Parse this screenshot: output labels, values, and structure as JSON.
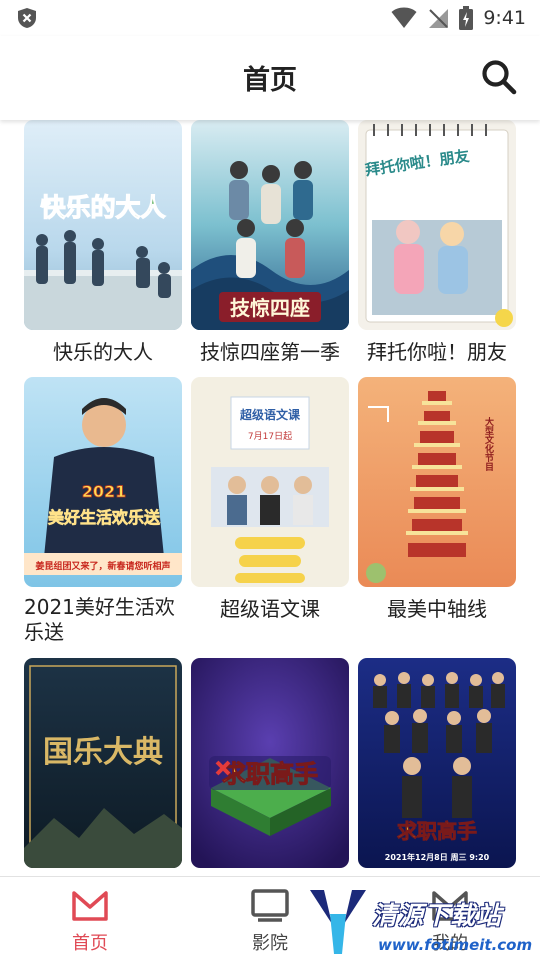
{
  "status_bar": {
    "time": "9:41"
  },
  "header": {
    "title": "首页"
  },
  "shows": [
    {
      "title": "快乐的大人"
    },
    {
      "title": "技惊四座第一季"
    },
    {
      "title": "拜托你啦！朋友"
    },
    {
      "title": "2021美好生活欢乐送"
    },
    {
      "title": "超级语文课"
    },
    {
      "title": "最美中轴线"
    },
    {
      "title": "",
      "poster_text": "国乐大典"
    },
    {
      "title": "",
      "poster_text": "求职高手"
    },
    {
      "title": "",
      "poster_text": "求职高手"
    }
  ],
  "posters": {
    "p1": "快乐的大人",
    "p2": "技惊四座",
    "p3": "拜托你啦！朋友",
    "p4_year": "2021",
    "p4_text": "美好生活欢乐送",
    "p4_banner": "姜昆组团又来了，新春请您听相声",
    "p5": "超级语文课",
    "p5_date": "7月17日起",
    "p6": "大型文化节目",
    "p7": "国乐大典",
    "p8": "求职高手",
    "p9": "求职高手",
    "p9_date": "2021年12月8日 周三 9:20"
  },
  "bottom_nav": [
    {
      "label": "首页",
      "active": true
    },
    {
      "label": "影院",
      "active": false
    },
    {
      "label": "我的",
      "active": false
    }
  ],
  "watermark": {
    "title": "清源下载站",
    "url": "www.fotimeit.com"
  },
  "colors": {
    "accent": "#e04a55",
    "icon_gray": "#555555"
  }
}
